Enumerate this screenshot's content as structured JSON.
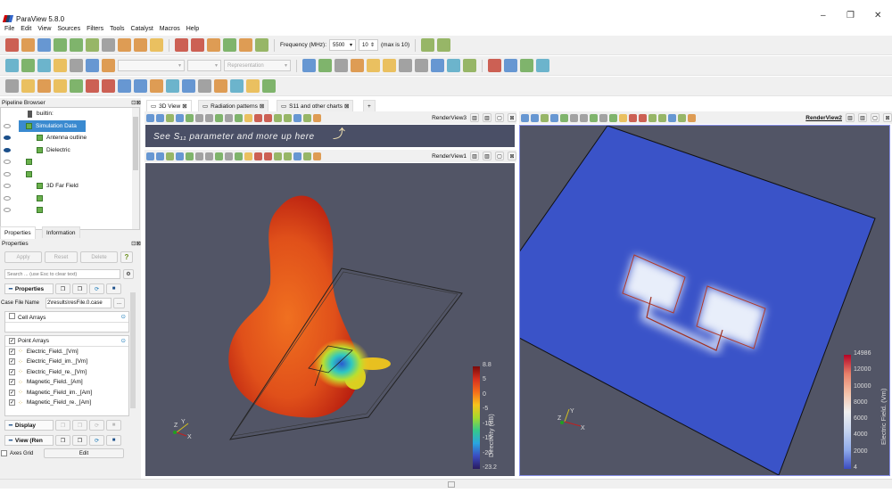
{
  "app": {
    "title": "ParaView 5.8.0",
    "window_controls": [
      "–",
      "❐",
      "✕"
    ]
  },
  "menu": [
    "File",
    "Edit",
    "View",
    "Sources",
    "Filters",
    "Tools",
    "Catalyst",
    "Macros",
    "Help"
  ],
  "toolbar1": {
    "icons": [
      "open-folder",
      "recent-folder",
      "load-state",
      "save-state",
      "autoapply",
      "undo",
      "redo",
      "connect",
      "server",
      "palette",
      "first-frame",
      "prev-frame",
      "play",
      "next-frame",
      "last-frame",
      "loop"
    ],
    "frequency_label": "Frequency (MHz):",
    "frequency_value": "5500",
    "step_value": "10",
    "max_label": "(max is 10)",
    "extra_icons": [
      "zoom-data",
      "zoom-add"
    ]
  },
  "toolbar2": {
    "icons": [
      "toggle-colorbar",
      "color-legend",
      "edit-colormap",
      "rescale-range",
      "rescale-custom",
      "rescale-visible",
      "rescale-temporal"
    ],
    "representation_placeholder": "Representation",
    "camera_icons": [
      "reset-camera",
      "zoom-closest",
      "zoom-box",
      "view-plus-x",
      "view-minus-x",
      "view-plus-y",
      "view-minus-y",
      "view-plus-z",
      "view-minus-z",
      "rotate-plus-90",
      "rotate-minus-90"
    ],
    "interaction_icons": [
      "center-axes",
      "pick-center",
      "show-center",
      "reset-center"
    ]
  },
  "toolbar3": {
    "icons": [
      "calculator",
      "contour",
      "clip",
      "slice",
      "threshold",
      "extract-subset",
      "glyph",
      "stream-tracer",
      "warp",
      "group",
      "extract-level",
      "extract-selection",
      "plot-over-line",
      "edit-data",
      "plot-data",
      "snowflake",
      "ruler"
    ]
  },
  "pipeline": {
    "title": "Pipeline Browser",
    "root": "builtin:",
    "items": [
      {
        "label": "Simulation Data",
        "visible": false,
        "selected": true,
        "level": 1
      },
      {
        "label": "Antenna outline",
        "visible": true,
        "level": 2
      },
      {
        "label": "Dielectric",
        "visible": true,
        "level": 2
      },
      {
        "label": "",
        "visible": false,
        "level": 1
      },
      {
        "label": "",
        "visible": false,
        "level": 1
      },
      {
        "label": "3D Far Field",
        "visible": false,
        "level": 2
      },
      {
        "label": "",
        "visible": false,
        "level": 2
      },
      {
        "label": "",
        "visible": false,
        "level": 2
      }
    ]
  },
  "panel_tabs": [
    "Properties",
    "Information"
  ],
  "properties": {
    "title": "Properties",
    "apply": "Apply",
    "reset": "Reset",
    "delete": "Delete",
    "help": "?",
    "search_placeholder": "Search ... (use Esc to clear text)",
    "section_properties": "Properties",
    "case_file_label": "Case File Name",
    "case_file_value": "2\\results\\resFile.0.case",
    "browse": "...",
    "cell_arrays": "Cell Arrays",
    "point_arrays": "Point Arrays",
    "arrays": [
      "Electric_Field._[Vm]",
      "Electric_Field_im._[Vm]",
      "Electric_Field_re._[Vm]",
      "Magnetic_Field._[Am]",
      "Magnetic_Field_im._[Am]",
      "Magnetic_Field_re._[Am]"
    ],
    "section_display": "Display",
    "section_view": "View (Ren",
    "axes_grid": "Axes Grid",
    "edit": "Edit"
  },
  "tabs": [
    "3D View",
    "Radiation patterns",
    "S11 and other charts",
    "+"
  ],
  "views": {
    "rv3": "RenderView3",
    "rv1": "RenderView1",
    "rv2": "RenderView2",
    "banner": "See S₁₁ parameter and more up here",
    "directivity": {
      "title": "Directivity (dB)",
      "ticks": [
        "8.8",
        "5",
        "0",
        "-5",
        "-10",
        "-15",
        "-20",
        "-23.2"
      ],
      "colors": [
        "#7a0a0a",
        "#d7301f",
        "#f46d1b",
        "#f7c31c",
        "#a6d92c",
        "#35c98a",
        "#2aa5e0",
        "#3b4cc0",
        "#2a1a5e"
      ]
    },
    "efield": {
      "title": "Electric Field. (Vm)",
      "ticks": [
        "14986",
        "12000",
        "10000",
        "8000",
        "6000",
        "4000",
        "2000",
        "4"
      ],
      "colors": [
        "#b40426",
        "#e8806a",
        "#f3c1a8",
        "#f0f0f0",
        "#c6d4f0",
        "#8fabeb",
        "#3b4cc0"
      ]
    },
    "axes": [
      "X",
      "Y",
      "Z"
    ]
  }
}
